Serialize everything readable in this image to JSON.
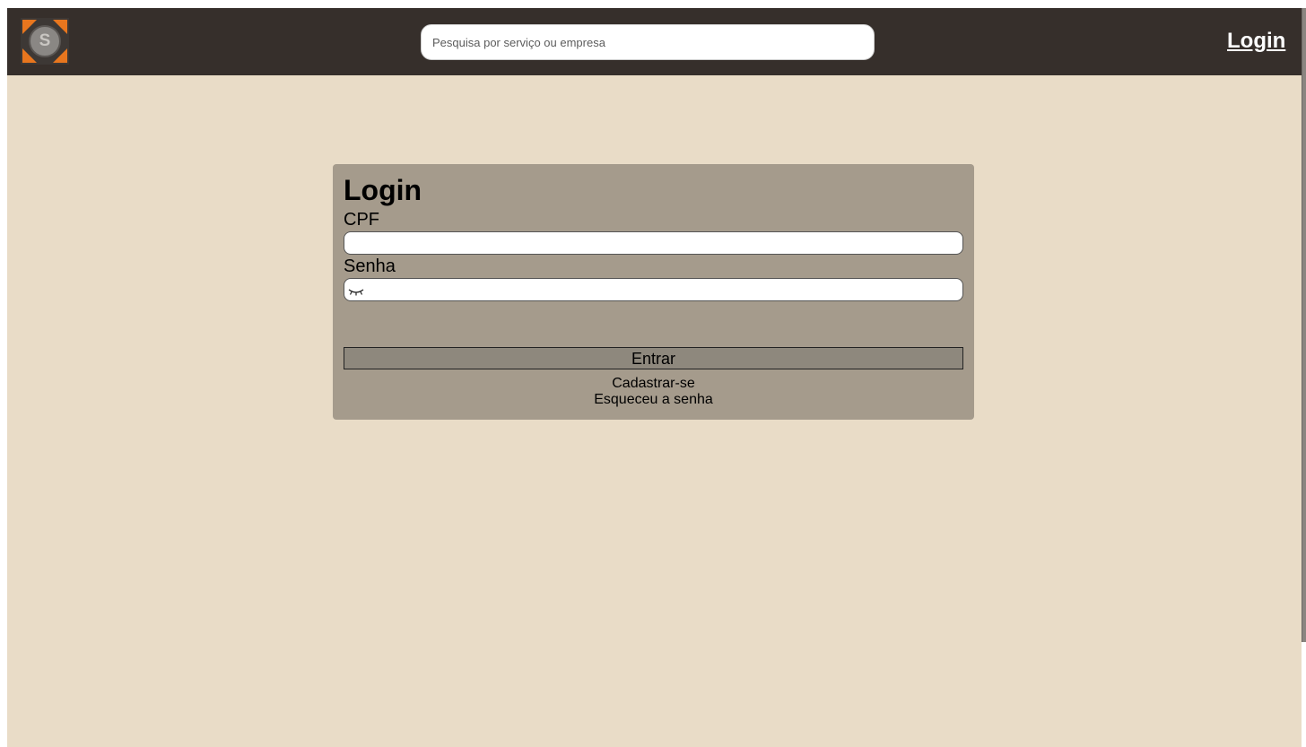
{
  "header": {
    "logo_letter": "S",
    "search_placeholder": "Pesquisa por serviço ou empresa",
    "login_link": "Login"
  },
  "login_form": {
    "title": "Login",
    "cpf_label": "CPF",
    "cpf_value": "",
    "password_label": "Senha",
    "password_value": "",
    "password_icon": "eye-closed-icon",
    "submit_label": "Entrar",
    "register_link": "Cadastrar-se",
    "forgot_link": "Esqueceu a senha"
  },
  "colors": {
    "header_bg": "#362f2b",
    "page_bg": "#e9dcc7",
    "card_bg": "#a59b8c",
    "button_bg": "#8e887d",
    "logo_accent": "#e8761e"
  }
}
